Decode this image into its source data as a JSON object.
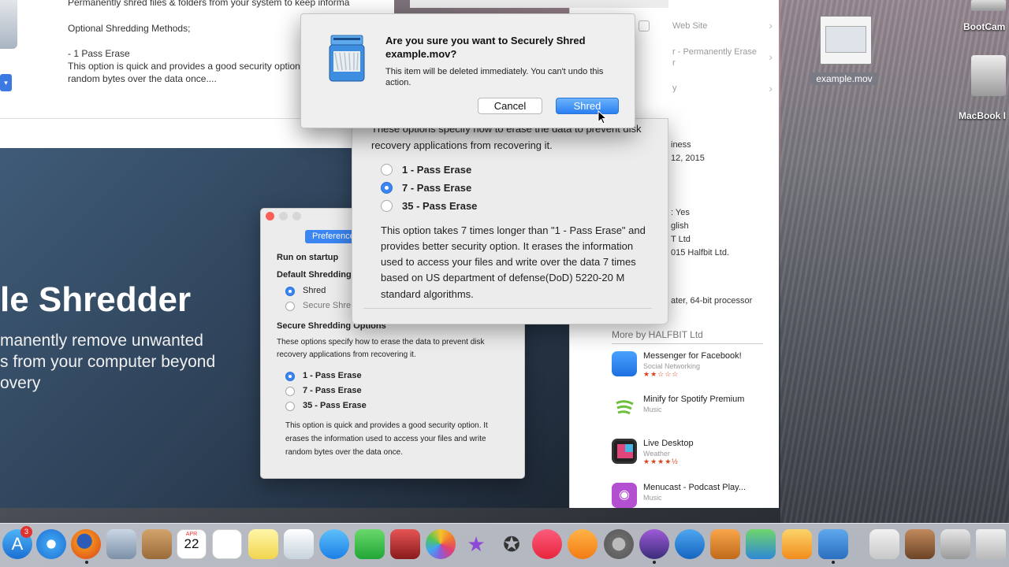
{
  "description_window": {
    "line1": "Permanently shred files & folders from your system to keep informa",
    "line2": "Optional Shredding Methods;",
    "line3": "- 1 Pass Erase",
    "line4": "This option is quick and provides a good security option",
    "line5": "random bytes over the data once...."
  },
  "store_sidebar": {
    "row1": "Web Site",
    "row2": "r - Permanently Erase",
    "row2b": "r",
    "row3": "y",
    "meta": [
      "iness",
      "12, 2015",
      ": Yes",
      "glish",
      "T Ltd",
      "015 Halfbit Ltd.",
      "ater, 64-bit processor"
    ],
    "more_by": "More by HALFBIT Ltd",
    "apps": [
      {
        "name": "Messenger for Facebook!",
        "category": "Social Networking",
        "stars": "★★☆☆☆"
      },
      {
        "name": "Minify for Spotify Premium",
        "category": "Music",
        "stars": ""
      },
      {
        "name": "Live Desktop",
        "category": "Weather",
        "stars": "★★★★½"
      },
      {
        "name": "Menucast - Podcast Play...",
        "category": "Music",
        "stars": ""
      }
    ]
  },
  "hero": {
    "title": "le Shredder",
    "sub1": "manently remove unwanted",
    "sub2": "s from your computer beyond",
    "sub3": "overy"
  },
  "prefs_window": {
    "tab": "Preferences",
    "run_on_startup": "Run on startup",
    "default_shredding": "Default Shredding",
    "opt_shred": "Shred",
    "opt_secure": "Secure Shre",
    "secure_options_heading": "Secure Shredding Options",
    "help1": "These options specify how to erase the data to prevent disk",
    "help2": "recovery applications from recovering it.",
    "erase1": "1 - Pass Erase",
    "erase7": "7 - Pass Erase",
    "erase35": "35 - Pass Erase",
    "desc1": "This option is quick and provides a good security option. It",
    "desc2": "erases the information used to access your files and write",
    "desc3": "random bytes over the data once."
  },
  "options_window": {
    "help1": "These options specify how to erase the data to prevent disk",
    "help2": "recovery applications from recovering it.",
    "erase1": "1 - Pass Erase",
    "erase7": "7 - Pass Erase",
    "erase35": "35 - Pass Erase",
    "desc": [
      "This option takes 7 times longer than \"1 - Pass Erase\" and",
      "provides better security option. It erases the information",
      "used to access your files and write over the data 7 times",
      "based on US department of defense(DoD) 5220-20 M",
      "standard algorithms."
    ]
  },
  "alert": {
    "title": "Are you sure you want to Securely Shred example.mov?",
    "message": "This item will be deleted immediately. You can't undo this action.",
    "cancel": "Cancel",
    "confirm": "Shred"
  },
  "desktop": {
    "file_label": "example.mov",
    "disk1": "BootCam",
    "disk2": "MacBook I"
  },
  "dock": {
    "badge": "3",
    "calendar_month": "APR",
    "calendar_day": "22"
  },
  "colors": {
    "accent": "#3b86f2",
    "hero": "#2c3f55",
    "star": "#d9441b"
  }
}
